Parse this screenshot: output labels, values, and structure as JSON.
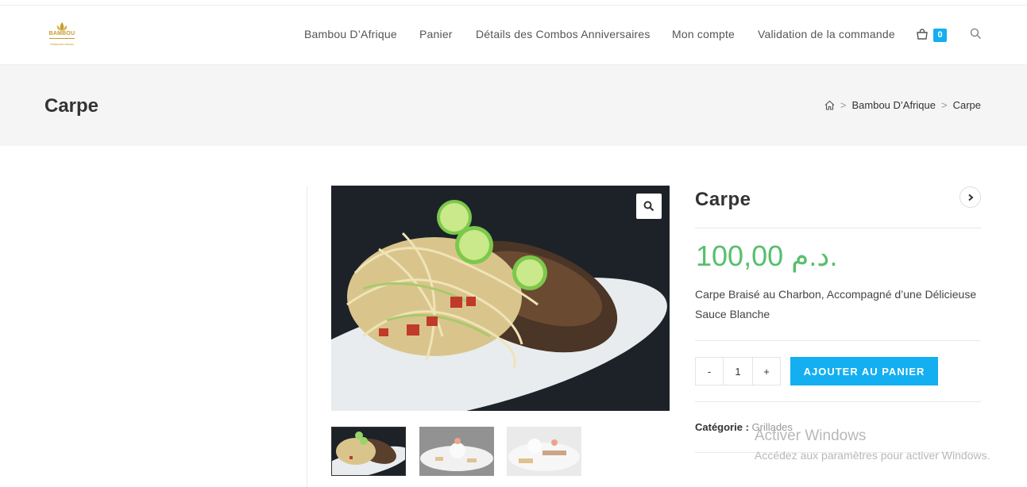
{
  "header": {
    "logo": {
      "name": "BAMBOU",
      "tagline": "Restaurant Africain"
    },
    "nav": [
      "Bambou D’Afrique",
      "Panier",
      "Détails des Combos Anniversaires",
      "Mon compte",
      "Validation de la commande"
    ],
    "cart_count": "0"
  },
  "title_band": {
    "title": "Carpe",
    "breadcrumb": [
      "Bambou D’Afrique",
      "Carpe"
    ]
  },
  "product": {
    "title": "Carpe",
    "price": "100,00 د.م.",
    "description": "Carpe Braisé au Charbon, Accompagné d’une Délicieuse Sauce Blanche",
    "quantity": "1",
    "qty_minus": "-",
    "qty_plus": "+",
    "add_to_cart": "AJOUTER AU PANIER",
    "category_label": "Catégorie :",
    "category_value": "Grillades"
  },
  "watermark": {
    "title": "Activer Windows",
    "subtitle": "Accédez aux paramètres pour activer Windows."
  },
  "colors": {
    "accent": "#13aff0",
    "price": "#57bf6d",
    "logo_gold": "#c69c2e"
  },
  "icons": [
    "cart-icon",
    "search-icon",
    "home-icon",
    "zoom-icon",
    "chevron-right-icon"
  ]
}
